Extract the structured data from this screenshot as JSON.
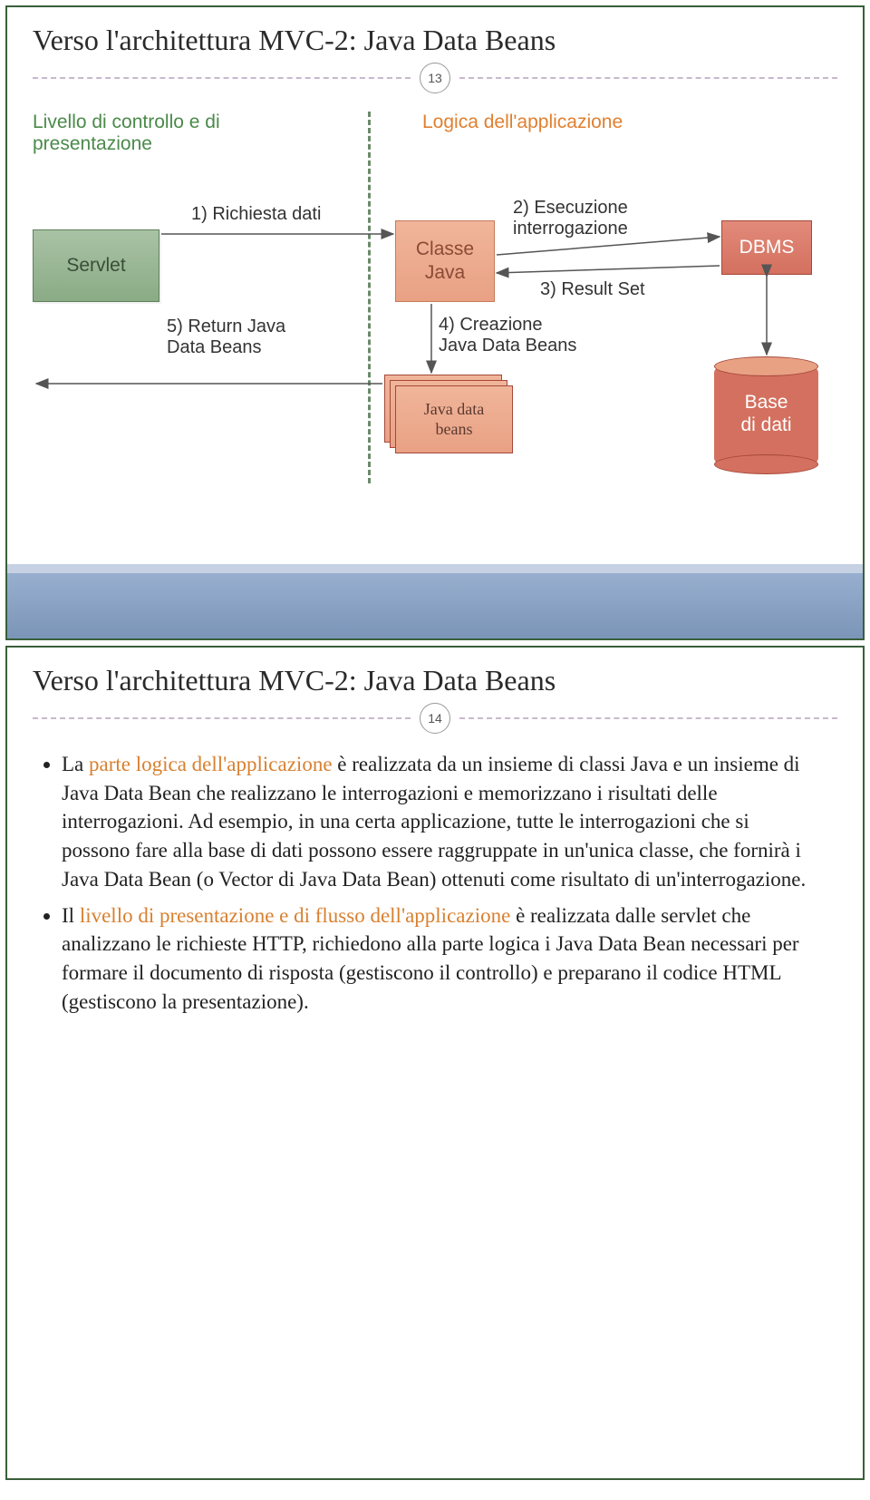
{
  "slide1": {
    "title": "Verso l'architettura MVC-2: Java Data Beans",
    "page": "13",
    "left_heading_l1": "Livello di controllo e di",
    "left_heading_l2": "presentazione",
    "right_heading": "Logica dell'applicazione",
    "servlet": "Servlet",
    "classe_l1": "Classe",
    "classe_l2": "Java",
    "dbms": "DBMS",
    "beans_label_l1": "Java data",
    "beans_label_l2": "beans",
    "db_l1": "Base",
    "db_l2": "di dati",
    "step1": "1) Richiesta dati",
    "step2_l1": "2) Esecuzione",
    "step2_l2": "interrogazione",
    "step3": "3) Result Set",
    "step4_l1": "4) Creazione",
    "step4_l2": "Java Data Beans",
    "step5_l1": "5) Return Java",
    "step5_l2": "Data Beans"
  },
  "slide2": {
    "title": "Verso l'architettura MVC-2: Java Data Beans",
    "page": "14",
    "bullet1_a": "La ",
    "bullet1_b": "parte logica dell'applicazione",
    "bullet1_c": " è realizzata da un insieme di classi Java e un insieme di Java Data Bean che realizzano le interrogazioni e memorizzano i risultati delle interrogazioni. Ad esempio, in una certa applicazione, tutte le interrogazioni che si possono fare alla base di dati possono essere raggruppate in un'unica classe, che fornirà i Java Data Bean (o Vector di Java Data Bean) ottenuti come risultato di un'interrogazione.",
    "bullet2_a": "Il ",
    "bullet2_b": "livello di presentazione e di flusso dell'applicazione",
    "bullet2_c": " è realizzata dalle servlet che analizzano le richieste HTTP, richiedono alla parte logica i Java Data Bean necessari per formare il documento di risposta (gestiscono il controllo) e preparano il codice HTML (gestiscono la presentazione)."
  }
}
